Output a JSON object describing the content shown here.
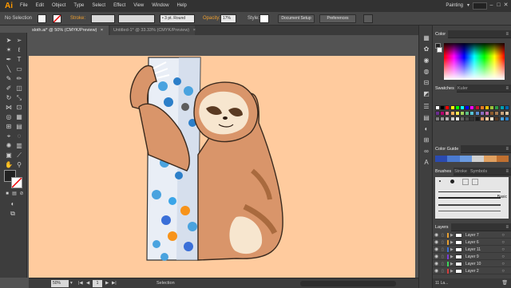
{
  "app": {
    "logo": "Ai",
    "menu": [
      "File",
      "Edit",
      "Object",
      "Type",
      "Select",
      "Effect",
      "View",
      "Window",
      "Help"
    ],
    "workspace": "Painting",
    "workspace_caret": "▾"
  },
  "control_bar": {
    "selection_label": "No Selection",
    "stroke_label": "Stroke:",
    "brush_size": "3 pt. Round",
    "opacity_label": "Opacity:",
    "opacity_value": "17%",
    "style_label": "Style:",
    "document_setup": "Document Setup",
    "preferences": "Preferences"
  },
  "tabs": [
    {
      "label": "sloth.ai* @ 50% (CMYK/Preview)",
      "active": true
    },
    {
      "label": "Untitled-1* @ 33.33% (CMYK/Preview)",
      "active": false
    }
  ],
  "status_bar": {
    "zoom": "50%",
    "page": "1",
    "tool": "Selection"
  },
  "panels": {
    "color": {
      "title": "Color"
    },
    "swatches": {
      "tabs": [
        "Swatches",
        "Kuler"
      ]
    },
    "color_guide": {
      "title": "Color Guide"
    },
    "brushes": {
      "tabs": [
        "Brushes",
        "Stroke",
        "Symbols"
      ],
      "basic_label": "Basic"
    },
    "layers": {
      "title": "Layers",
      "rows": [
        {
          "name": "Layer 7",
          "color": "#e8a030"
        },
        {
          "name": "Layer 6",
          "color": "#e8a030"
        },
        {
          "name": "Layer 11",
          "color": "#3b6fd4"
        },
        {
          "name": "Layer 9",
          "color": "#7a3bd4"
        },
        {
          "name": "Layer 10",
          "color": "#3bd45a"
        },
        {
          "name": "Layer 2",
          "color": "#d43b3b"
        }
      ],
      "footer": "11 La..."
    }
  },
  "colors": {
    "artboard": "#ffcb9e",
    "sloth_fur": "#d9956a",
    "sloth_dark": "#a96a3e",
    "sloth_face": "#f7e6cf",
    "tree": "#e9eef6"
  }
}
